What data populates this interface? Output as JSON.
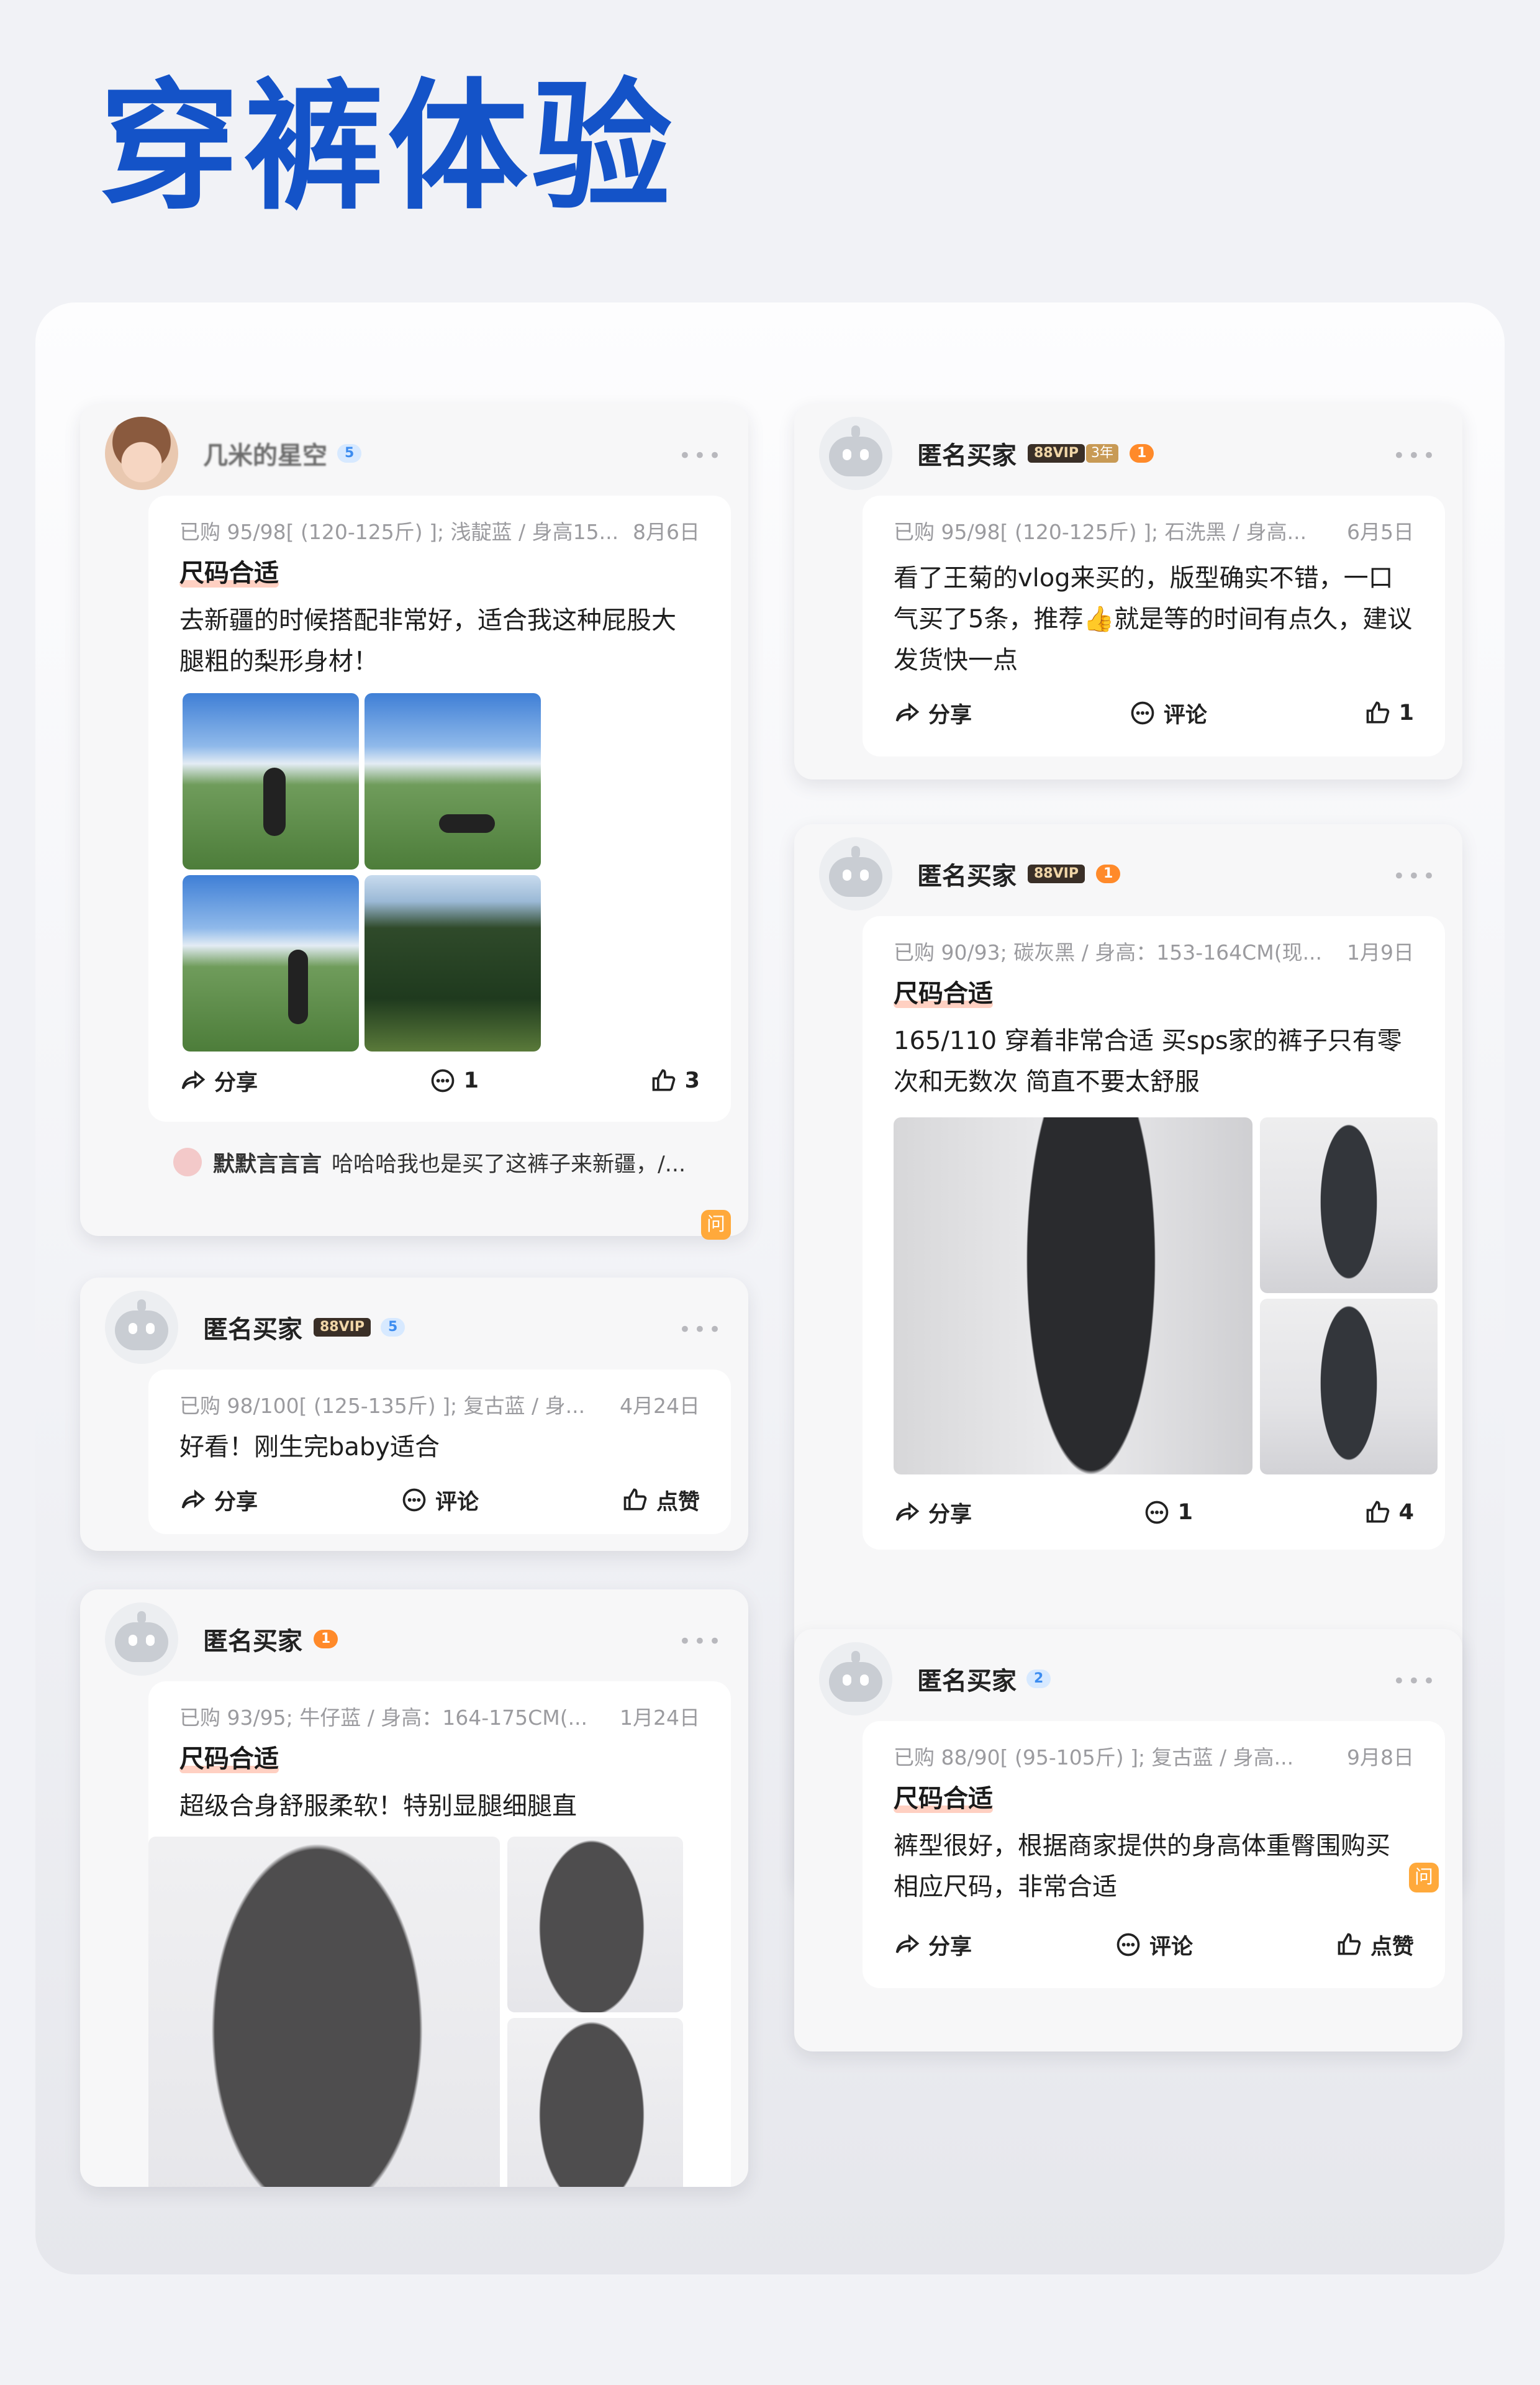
{
  "title": "穿裤体验",
  "cards": [
    {
      "user": "几米的星空",
      "badges": {
        "diamond": "5"
      },
      "meta": "已购 95/98[ (120-125斤) ]; 浅靛蓝 / 身高15...",
      "date": "8月6日",
      "fit": "尺码合适",
      "text": "去新疆的时候搭配非常好，适合我这种屁股大腿粗的梨形身材！",
      "share": "分享",
      "comments": "1",
      "likes": "3",
      "comment_preview": {
        "user": "默默言言言",
        "text": "哈哈哈我也是买了这裤子来新疆，/..."
      },
      "ask": "问"
    },
    {
      "user": "匿名买家",
      "badges": {
        "vip": "88VIP",
        "year": "3年",
        "crown": "1"
      },
      "meta": "已购 95/98[ (120-125斤) ]; 石洗黑 / 身高...",
      "date": "6月5日",
      "text": "看了王菊的vlog来买的，版型确实不错，一口气买了5条，推荐👍就是等的时间有点久，建议发货快一点",
      "share": "分享",
      "comments": "评论",
      "likes": "1"
    },
    {
      "user": "匿名买家",
      "badges": {
        "vip": "88VIP",
        "diamond": "5"
      },
      "meta": "已购 98/100[ (125-135斤) ]; 复古蓝 / 身...",
      "date": "4月24日",
      "text": "好看！刚生完baby适合",
      "share": "分享",
      "comments": "评论",
      "likes": "点赞"
    },
    {
      "user": "匿名买家",
      "badges": {
        "vip": "88VIP",
        "crown": "1"
      },
      "meta": "已购 90/93; 碳灰黑 / 身高：153-164CM(现...",
      "date": "1月9日",
      "fit": "尺码合适",
      "text": "165/110 穿着非常合适 买sps家的裤子只有零次和无数次 简直不要太舒服",
      "share": "分享",
      "comments": "1",
      "likes": "4"
    },
    {
      "user": "匿名买家",
      "badges": {
        "crown": "1"
      },
      "meta": "已购 93/95; 牛仔蓝 / 身高：164-175CM(...",
      "date": "1月24日",
      "fit": "尺码合适",
      "text": "超级合身舒服柔软！特别显腿细腿直"
    },
    {
      "user": "匿名买家",
      "badges": {
        "diamond": "2"
      },
      "meta": "已购 88/90[ (95-105斤) ]; 复古蓝 / 身高...",
      "date": "9月8日",
      "fit": "尺码合适",
      "text": "裤型很好，根据商家提供的身高体重臀围购买相应尺码，非常合适",
      "share": "分享",
      "comments": "评论",
      "likes": "点赞",
      "ask": "问"
    }
  ]
}
